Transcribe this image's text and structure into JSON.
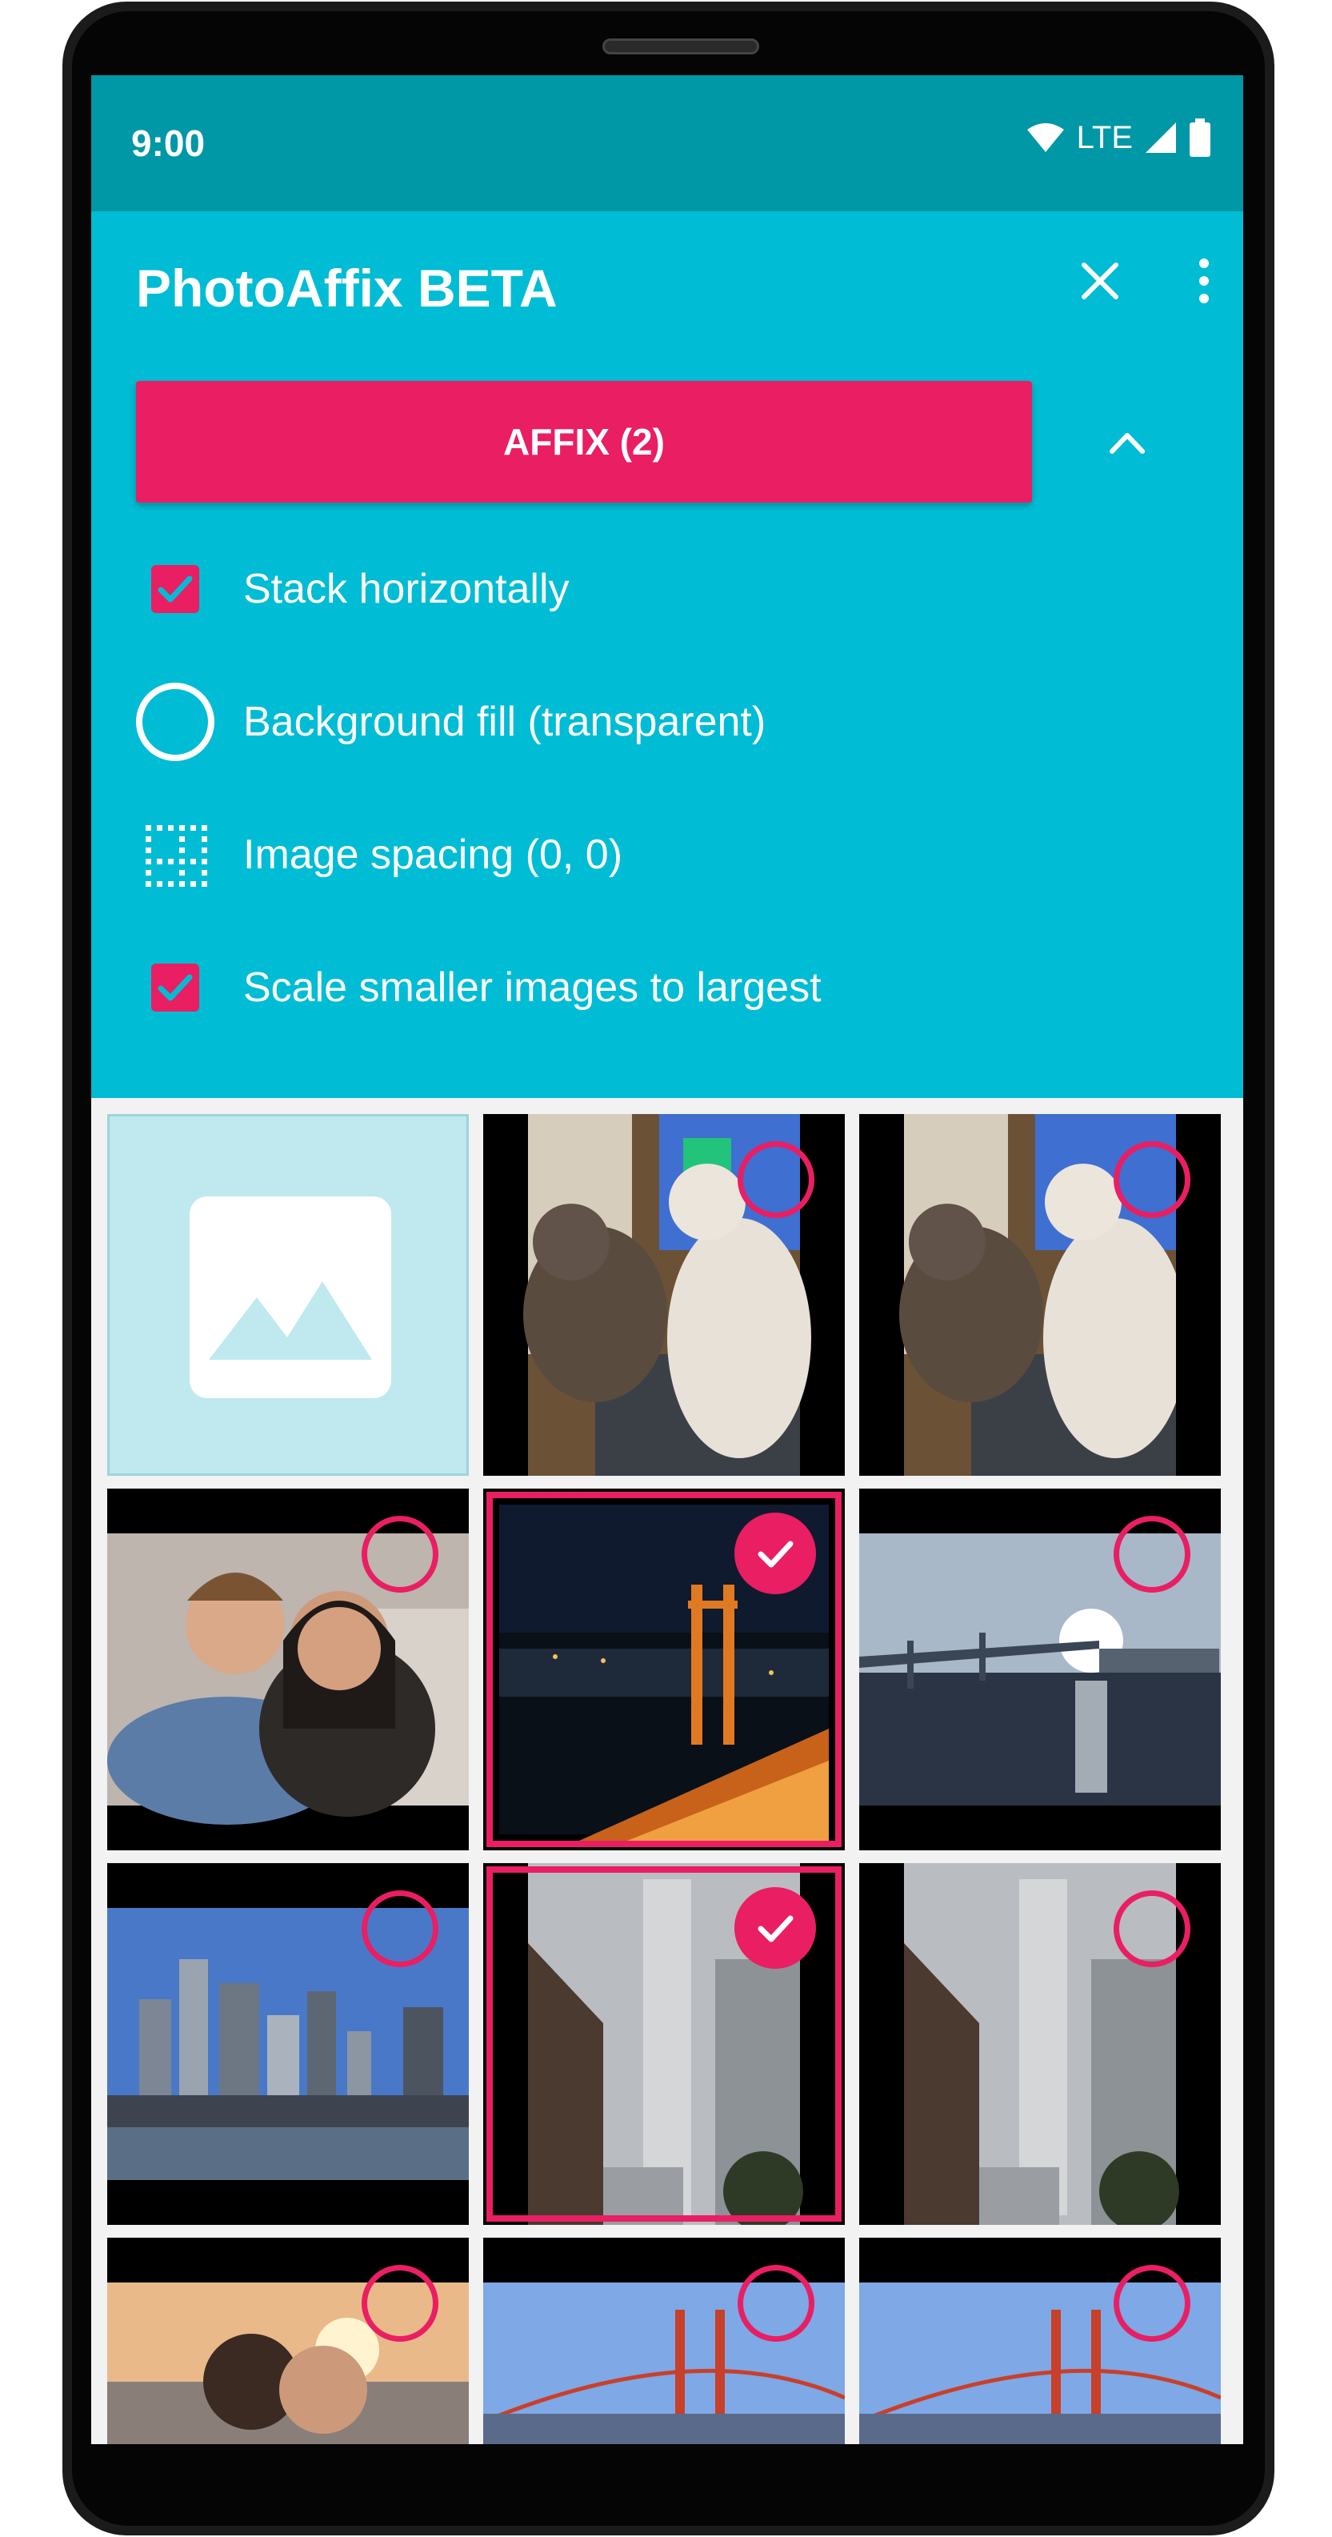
{
  "status_bar": {
    "time": "9:00",
    "network": "LTE",
    "icons": [
      "wifi-icon",
      "signal-icon",
      "battery-icon"
    ]
  },
  "app_bar": {
    "title": "PhotoAffix BETA",
    "actions": [
      "close-icon",
      "more-vert-icon"
    ]
  },
  "affix_button": {
    "label": "AFFIX (2)"
  },
  "collapse_icon": "chevron-up-icon",
  "options": [
    {
      "label": "Stack horizontally",
      "icon": "checkbox-checked-icon",
      "checked": true
    },
    {
      "label": "Background fill (transparent)",
      "icon": "circle-outline-icon"
    },
    {
      "label": "Image spacing (0, 0)",
      "icon": "spacing-grid-icon"
    },
    {
      "label": "Scale smaller images to largest",
      "icon": "checkbox-checked-icon",
      "checked": true
    }
  ],
  "grid": {
    "tiles": [
      {
        "type": "placeholder",
        "icon": "image-placeholder-icon"
      },
      {
        "type": "photo",
        "subject": "cats",
        "selected": false
      },
      {
        "type": "photo",
        "subject": "cats",
        "selected": false
      },
      {
        "type": "photo",
        "subject": "couple selfie",
        "selected": false
      },
      {
        "type": "photo",
        "subject": "golden gate night",
        "selected": true
      },
      {
        "type": "photo",
        "subject": "bay bridge sunset",
        "selected": false
      },
      {
        "type": "photo",
        "subject": "skyline",
        "selected": false
      },
      {
        "type": "photo",
        "subject": "fog tower",
        "selected": true
      },
      {
        "type": "photo",
        "subject": "fog tower",
        "selected": false
      },
      {
        "type": "photo",
        "subject": "beach sunset",
        "selected": false
      },
      {
        "type": "photo",
        "subject": "golden gate day",
        "selected": false
      },
      {
        "type": "photo",
        "subject": "golden gate day",
        "selected": false
      }
    ]
  },
  "colors": {
    "status_bar": "#0097a7",
    "app_bar": "#00bcd4",
    "accent": "#e91e63",
    "placeholder": "#bfe9ee"
  }
}
